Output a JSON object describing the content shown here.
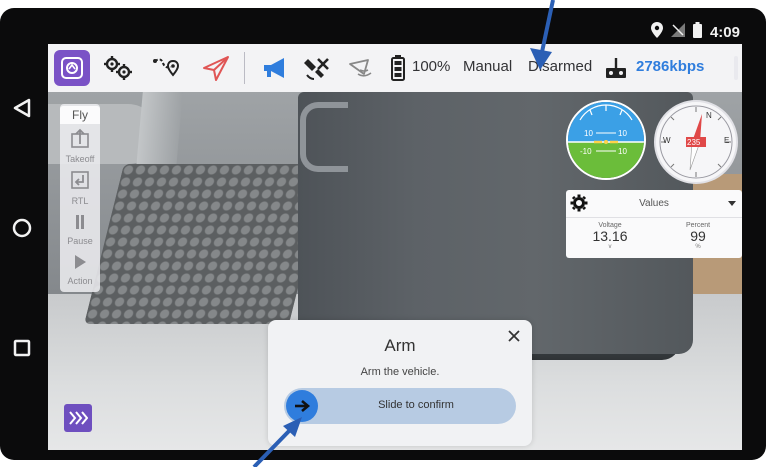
{
  "android": {
    "time": "4:09"
  },
  "toolbar": {
    "battery_text": "100%",
    "flight_mode": "Manual",
    "arm_state": "Disarmed",
    "link_rate": "2786kbps"
  },
  "fly_tools": {
    "title": "Fly",
    "items": [
      {
        "label": "Takeoff"
      },
      {
        "label": "RTL"
      },
      {
        "label": "Pause"
      },
      {
        "label": "Action"
      }
    ]
  },
  "attitude": {
    "upper_left": "10",
    "upper_right": "10",
    "lower_left": "-10",
    "lower_right": "10"
  },
  "compass": {
    "heading": "235",
    "north": "N",
    "east": "E",
    "west": "W"
  },
  "values_panel": {
    "title": "Values",
    "cells": [
      {
        "label": "Voltage",
        "value": "13.16",
        "unit": "v"
      },
      {
        "label": "Percent",
        "value": "99",
        "unit": "%"
      }
    ]
  },
  "arm_dialog": {
    "title": "Arm",
    "message": "Arm the vehicle.",
    "slider_label": "Slide to confirm"
  },
  "colors": {
    "accent_purple": "#7a52c6",
    "link_blue": "#2f7ddd",
    "slider_track": "#b7cbe3",
    "toolbar_bg": "#f3f3f5"
  }
}
